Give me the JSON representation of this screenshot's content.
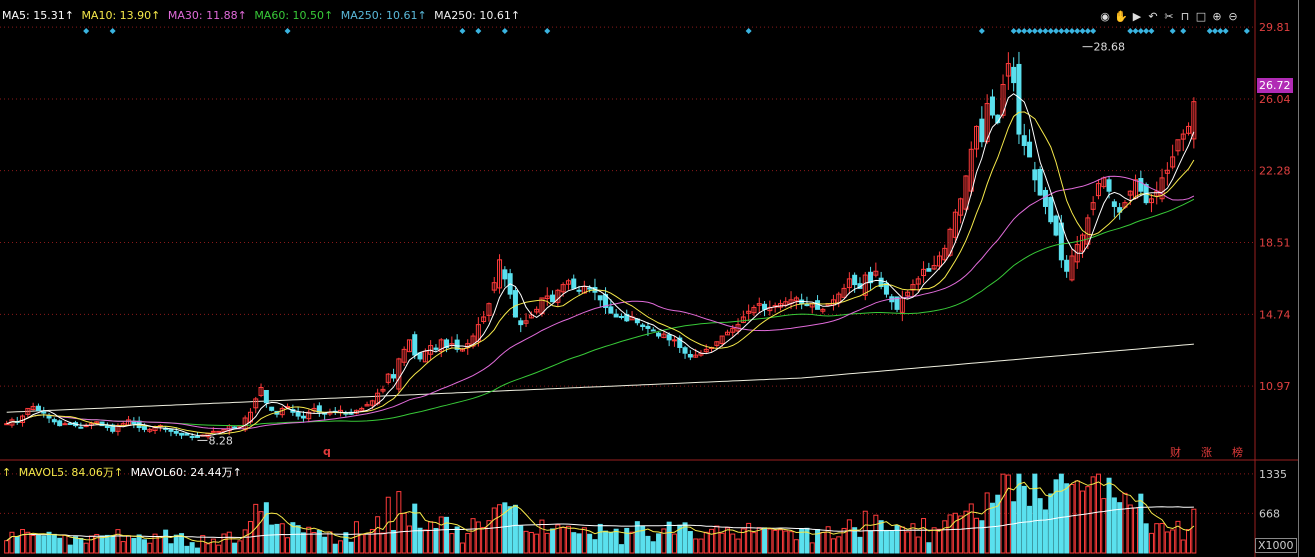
{
  "ma_legend": [
    {
      "label": "MA5: 15.31↑",
      "color": "#ffffff"
    },
    {
      "label": "MA10: 13.90↑",
      "color": "#f5e84a"
    },
    {
      "label": "MA30: 11.88↑",
      "color": "#e06bd9"
    },
    {
      "label": "MA60: 10.50↑",
      "color": "#38c938"
    },
    {
      "label": "MA250: 10.61↑",
      "color": "#5ab8d8"
    },
    {
      "label": "MA250: 10.61↑",
      "color": "#f0f0f0"
    }
  ],
  "vol_legend": [
    {
      "label": "MAVOL5: 84.06万↑",
      "color": "#f5e84a"
    },
    {
      "label": "MAVOL60: 24.44万↑",
      "color": "#ffffff"
    }
  ],
  "toolbar_icons": [
    "eye-icon",
    "hand-icon",
    "play-icon",
    "undo-icon",
    "scissors-icon",
    "lock-icon",
    "square-icon",
    "zoom-in-icon",
    "zoom-out-icon"
  ],
  "badges": [
    "财",
    "涨",
    "榜"
  ],
  "q_mark": "q",
  "volume_unit": "X1000",
  "current_price_label": "26.72",
  "chart_data": {
    "type": "candlestick",
    "price_axis": {
      "ticks": [
        29.81,
        26.04,
        22.28,
        18.51,
        14.74,
        10.97
      ],
      "ylim": [
        7.2,
        30.5
      ]
    },
    "volume_axis": {
      "ticks": [
        1335,
        668
      ],
      "ylim": [
        0,
        1400
      ]
    },
    "annotations": [
      {
        "text": "28.68",
        "value": 28.68,
        "index": 203
      },
      {
        "text": "8.28",
        "value": 8.28,
        "index": 36
      }
    ],
    "current_price": 26.72,
    "ma_last": {
      "MA5": 15.31,
      "MA10": 13.9,
      "MA30": 11.88,
      "MA60": 10.5,
      "MA250": 10.61
    },
    "colors": {
      "up": "#ff3b3b",
      "down": "#5ae0ee",
      "ma5": "#ffffff",
      "ma10": "#f5e84a",
      "ma30": "#e06bd9",
      "ma60": "#38c938",
      "ma250": "#f0f0e0",
      "grid": "#8a1a1a",
      "axis": "#9a1f1f",
      "diamond": "#3ab4e0"
    },
    "closes": [
      9.0,
      9.2,
      9.1,
      9.4,
      9.8,
      9.9,
      9.7,
      9.6,
      9.3,
      9.1,
      8.9,
      9.0,
      9.0,
      8.9,
      8.8,
      8.9,
      9.0,
      9.1,
      8.9,
      8.8,
      8.6,
      8.9,
      9.0,
      9.2,
      9.0,
      8.8,
      8.7,
      8.7,
      8.8,
      8.9,
      8.7,
      8.6,
      8.5,
      8.4,
      8.4,
      8.3,
      8.3,
      8.4,
      8.5,
      8.6,
      8.6,
      8.7,
      8.9,
      8.8,
      8.9,
      9.3,
      9.6,
      10.3,
      10.9,
      10.1,
      9.7,
      9.5,
      9.8,
      9.9,
      9.6,
      9.4,
      9.3,
      9.6,
      9.8,
      9.6,
      9.5,
      9.6,
      9.6,
      9.7,
      9.5,
      9.5,
      9.7,
      9.8,
      10.0,
      10.2,
      10.6,
      10.8,
      11.6,
      11.4,
      12.4,
      12.9,
      13.4,
      12.6,
      12.4,
      12.8,
      13.1,
      12.9,
      13.4,
      13.0,
      13.2,
      12.9,
      12.9,
      13.2,
      13.6,
      14.2,
      14.6,
      15.3,
      16.4,
      17.6,
      16.6,
      15.8,
      14.6,
      14.2,
      14.4,
      14.7,
      15.0,
      15.6,
      15.7,
      15.4,
      16.0,
      16.3,
      16.5,
      16.1,
      16.0,
      16.2,
      16.1,
      15.9,
      15.5,
      15.1,
      14.8,
      14.6,
      14.6,
      14.4,
      14.6,
      14.3,
      14.1,
      14.0,
      13.9,
      13.6,
      13.7,
      13.4,
      13.4,
      13.0,
      12.7,
      12.5,
      12.6,
      12.7,
      12.9,
      13.0,
      13.3,
      13.6,
      13.8,
      14.0,
      14.2,
      14.6,
      14.9,
      15.1,
      15.3,
      15.0,
      15.1,
      15.2,
      15.3,
      15.4,
      15.5,
      15.6,
      15.3,
      15.2,
      15.3,
      15.0,
      15.0,
      15.3,
      15.5,
      15.8,
      16.1,
      16.6,
      16.3,
      16.1,
      16.8,
      16.4,
      17.0,
      16.2,
      15.8,
      15.4,
      15.0,
      15.6,
      15.9,
      16.3,
      16.6,
      17.1,
      17.0,
      17.3,
      17.8,
      18.2,
      19.2,
      20.1,
      20.8,
      22.0,
      23.4,
      24.6,
      23.8,
      25.8,
      25.2,
      24.8,
      26.8,
      27.9,
      26.9,
      24.2,
      23.6,
      23.0,
      21.8,
      21.0,
      20.4,
      19.6,
      18.9,
      17.6,
      17.0,
      17.8,
      18.4,
      18.9,
      19.8,
      20.6,
      21.6,
      21.9,
      21.2,
      20.4,
      20.1,
      20.6,
      21.2,
      21.8,
      21.2,
      20.6,
      20.8,
      21.2,
      21.9,
      22.3,
      23.0,
      23.9,
      24.2,
      24.6,
      25.9
    ]
  }
}
